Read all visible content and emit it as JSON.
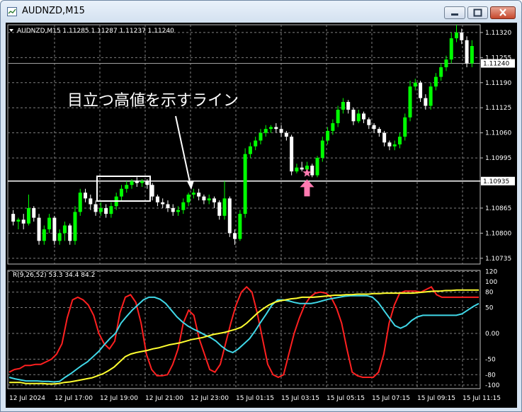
{
  "window": {
    "title": "AUDNZD,M15"
  },
  "colors": {
    "background": "#000000",
    "bull": "#00ff00",
    "bear": "#ffffff",
    "grid": "#7f7f7f",
    "red_line": "#ff2020",
    "cyan_line": "#40d8e8",
    "yellow_line": "#ffff30",
    "marker": "#ff7ab0"
  },
  "chart_data": [
    {
      "type": "candlestick",
      "header": "AUDNZD,M15  1.11285 1.11287 1.11237 1.11240",
      "ylim": [
        1.1072,
        1.1134
      ],
      "y_ticks": [
        "1.11320",
        "1.11255",
        "1.11190",
        "1.11125",
        "1.11060",
        "1.10995",
        "1.10935",
        "1.10865",
        "1.10800",
        "1.10735"
      ],
      "current_price_label": "1.11240",
      "current_price": 1.1124,
      "horizontal_line_label": "1.10935",
      "horizontal_line_price": 1.10935,
      "x_ticks": [
        "12 Jul 2024",
        "12 Jul 17:00",
        "12 Jul 19:00",
        "12 Jul 21:00",
        "12 Jul 23:00",
        "15 Jul 01:15",
        "15 Jul 03:15",
        "15 Jul 05:15",
        "15 Jul 07:15",
        "15 Jul 09:15",
        "15 Jul 11:15"
      ],
      "annotation_text": "目立つ高値を示すライン",
      "candles": [
        [
          1.1085,
          1.1083,
          1.1086,
          1.1082
        ],
        [
          1.1083,
          1.10835,
          1.1084,
          1.1081
        ],
        [
          1.10835,
          1.10825,
          1.1085,
          1.1081
        ],
        [
          1.10825,
          1.10865,
          1.109,
          1.1082
        ],
        [
          1.10865,
          1.1084,
          1.1087,
          1.1083
        ],
        [
          1.1084,
          1.1078,
          1.1085,
          1.1077
        ],
        [
          1.1078,
          1.1081,
          1.1082,
          1.1077
        ],
        [
          1.1081,
          1.1084,
          1.1085,
          1.108
        ],
        [
          1.1084,
          1.1078,
          1.10845,
          1.1077
        ],
        [
          1.1078,
          1.108,
          1.1081,
          1.1077
        ],
        [
          1.108,
          1.1082,
          1.1083,
          1.1078
        ],
        [
          1.1082,
          1.1078,
          1.10825,
          1.1077
        ],
        [
          1.1078,
          1.10855,
          1.1087,
          1.1077
        ],
        [
          1.10855,
          1.10905,
          1.10915,
          1.10845
        ],
        [
          1.10905,
          1.1089,
          1.10915,
          1.1088
        ],
        [
          1.1089,
          1.10875,
          1.109,
          1.1086
        ],
        [
          1.10875,
          1.10855,
          1.10885,
          1.10845
        ],
        [
          1.10855,
          1.10865,
          1.1088,
          1.10845
        ],
        [
          1.10865,
          1.1085,
          1.10875,
          1.1084
        ],
        [
          1.1085,
          1.1087,
          1.1088,
          1.1084
        ],
        [
          1.1087,
          1.10895,
          1.10905,
          1.1086
        ],
        [
          1.10895,
          1.10915,
          1.10925,
          1.10885
        ],
        [
          1.10915,
          1.10925,
          1.10935,
          1.10905
        ],
        [
          1.10925,
          1.10935,
          1.1094,
          1.10915
        ],
        [
          1.10935,
          1.1093,
          1.10945,
          1.1092
        ],
        [
          1.1093,
          1.10935,
          1.1094,
          1.1092
        ],
        [
          1.10935,
          1.10925,
          1.1094,
          1.10915
        ],
        [
          1.10925,
          1.10895,
          1.1093,
          1.10885
        ],
        [
          1.10895,
          1.1088,
          1.109,
          1.1087
        ],
        [
          1.1088,
          1.10875,
          1.1089,
          1.10865
        ],
        [
          1.10875,
          1.10865,
          1.10885,
          1.10855
        ],
        [
          1.10865,
          1.10855,
          1.10875,
          1.10845
        ],
        [
          1.10855,
          1.1086,
          1.1087,
          1.10845
        ],
        [
          1.1086,
          1.1088,
          1.1089,
          1.1085
        ],
        [
          1.1088,
          1.109,
          1.10905,
          1.1087
        ],
        [
          1.109,
          1.10905,
          1.10915,
          1.1089
        ],
        [
          1.10905,
          1.10895,
          1.10915,
          1.10885
        ],
        [
          1.10895,
          1.10885,
          1.109,
          1.10875
        ],
        [
          1.10885,
          1.1089,
          1.109,
          1.10875
        ],
        [
          1.1089,
          1.1088,
          1.10895,
          1.10865
        ],
        [
          1.1088,
          1.10845,
          1.10885,
          1.10835
        ],
        [
          1.10845,
          1.1089,
          1.10935,
          1.10835
        ],
        [
          1.1089,
          1.108,
          1.10895,
          1.1079
        ],
        [
          1.108,
          1.10785,
          1.1081,
          1.1077
        ],
        [
          1.10785,
          1.1085,
          1.1086,
          1.1078
        ],
        [
          1.1085,
          1.11005,
          1.1102,
          1.1084
        ],
        [
          1.11005,
          1.11025,
          1.11035,
          1.10995
        ],
        [
          1.11025,
          1.1104,
          1.1105,
          1.11015
        ],
        [
          1.1104,
          1.1106,
          1.1107,
          1.1103
        ],
        [
          1.1106,
          1.1107,
          1.1108,
          1.1105
        ],
        [
          1.1107,
          1.11075,
          1.1108,
          1.1106
        ],
        [
          1.11075,
          1.1107,
          1.11085,
          1.1106
        ],
        [
          1.1107,
          1.1106,
          1.1108,
          1.1105
        ],
        [
          1.1106,
          1.1105,
          1.11065,
          1.1104
        ],
        [
          1.1105,
          1.1096,
          1.11055,
          1.1095
        ],
        [
          1.1096,
          1.1097,
          1.1098,
          1.10955
        ],
        [
          1.1097,
          1.10965,
          1.10985,
          1.1096
        ],
        [
          1.10965,
          1.10975,
          1.10985,
          1.1096
        ],
        [
          1.10975,
          1.1095,
          1.1098,
          1.10945
        ],
        [
          1.1095,
          1.10995,
          1.11,
          1.10945
        ],
        [
          1.10995,
          1.1104,
          1.1105,
          1.10985
        ],
        [
          1.1104,
          1.11065,
          1.11075,
          1.1103
        ],
        [
          1.11065,
          1.11085,
          1.11095,
          1.11055
        ],
        [
          1.11085,
          1.1112,
          1.1113,
          1.11075
        ],
        [
          1.1112,
          1.1114,
          1.1115,
          1.1111
        ],
        [
          1.1114,
          1.1112,
          1.11145,
          1.1111
        ],
        [
          1.1112,
          1.1109,
          1.11125,
          1.1108
        ],
        [
          1.1109,
          1.1111,
          1.1112,
          1.11085
        ],
        [
          1.1111,
          1.11095,
          1.11115,
          1.11085
        ],
        [
          1.11095,
          1.1108,
          1.111,
          1.1107
        ],
        [
          1.1108,
          1.1107,
          1.11085,
          1.1106
        ],
        [
          1.1107,
          1.1106,
          1.11075,
          1.1105
        ],
        [
          1.1106,
          1.11035,
          1.11065,
          1.11025
        ],
        [
          1.11035,
          1.11025,
          1.1104,
          1.11015
        ],
        [
          1.11025,
          1.1103,
          1.1104,
          1.11015
        ],
        [
          1.1103,
          1.1105,
          1.1106,
          1.1102
        ],
        [
          1.1105,
          1.111,
          1.1111,
          1.1104
        ],
        [
          1.111,
          1.1118,
          1.11195,
          1.1109
        ],
        [
          1.1118,
          1.1119,
          1.112,
          1.1117
        ],
        [
          1.1119,
          1.1115,
          1.11195,
          1.1114
        ],
        [
          1.1115,
          1.1113,
          1.1116,
          1.1112
        ],
        [
          1.1113,
          1.1118,
          1.1119,
          1.1112
        ],
        [
          1.1118,
          1.11205,
          1.11215,
          1.1117
        ],
        [
          1.11205,
          1.1123,
          1.1124,
          1.11195
        ],
        [
          1.1123,
          1.1125,
          1.1126,
          1.1122
        ],
        [
          1.1125,
          1.11305,
          1.1132,
          1.1124
        ],
        [
          1.11305,
          1.1132,
          1.1134,
          1.11295
        ],
        [
          1.1132,
          1.113,
          1.1133,
          1.1129
        ],
        [
          1.113,
          1.1124,
          1.1131,
          1.1123
        ],
        [
          1.1124,
          1.11285,
          1.113,
          1.1123
        ]
      ]
    },
    {
      "type": "line",
      "label": "R(9,26,52) 53.3 34.4 84.2",
      "ylim": [
        -107,
        122
      ],
      "y_ticks": [
        120,
        100,
        80,
        50,
        0.0,
        -50,
        -80,
        -100
      ],
      "series": [
        {
          "color": "#ff2020",
          "values": [
            -75,
            -70,
            -68,
            -62,
            -62,
            -60,
            -60,
            -55,
            -50,
            -40,
            -20,
            30,
            65,
            70,
            65,
            55,
            35,
            0,
            -20,
            -30,
            -15,
            40,
            70,
            75,
            60,
            20,
            -40,
            -70,
            -82,
            -82,
            -80,
            -60,
            -30,
            20,
            45,
            35,
            -10,
            -40,
            -70,
            -75,
            -60,
            -20,
            20,
            55,
            80,
            90,
            80,
            40,
            -10,
            -60,
            -80,
            -85,
            -80,
            -40,
            0,
            30,
            55,
            70,
            78,
            80,
            78,
            70,
            50,
            20,
            -30,
            -75,
            -82,
            -85,
            -85,
            -85,
            -75,
            -40,
            20,
            55,
            78,
            82,
            82,
            82,
            80,
            85,
            90,
            75,
            70,
            70,
            70,
            70,
            70,
            70,
            70,
            70
          ]
        },
        {
          "color": "#40d8e8",
          "values": [
            -85,
            -88,
            -90,
            -92,
            -92,
            -92,
            -93,
            -93,
            -94,
            -93,
            -85,
            -78,
            -70,
            -62,
            -55,
            -45,
            -35,
            -22,
            -10,
            0,
            20,
            33,
            45,
            55,
            65,
            70,
            70,
            66,
            58,
            45,
            32,
            22,
            14,
            8,
            3,
            -3,
            -8,
            -15,
            -25,
            -33,
            -37,
            -30,
            -20,
            -10,
            5,
            22,
            38,
            55,
            65,
            65,
            63,
            60,
            58,
            58,
            58,
            60,
            63,
            66,
            68,
            70,
            72,
            73,
            73,
            73,
            73,
            70,
            60,
            45,
            30,
            15,
            10,
            15,
            25,
            32,
            35,
            35,
            35,
            35,
            35,
            35,
            35,
            38,
            45,
            52,
            58
          ]
        },
        {
          "color": "#ffff30",
          "values": [
            -95,
            -95,
            -95,
            -97,
            -97,
            -97,
            -97,
            -98,
            -98,
            -97,
            -95,
            -94,
            -92,
            -90,
            -88,
            -86,
            -82,
            -78,
            -72,
            -65,
            -55,
            -45,
            -40,
            -37,
            -35,
            -33,
            -30,
            -28,
            -25,
            -22,
            -20,
            -18,
            -15,
            -12,
            -10,
            -8,
            -5,
            -2,
            0,
            2,
            5,
            8,
            12,
            20,
            30,
            40,
            48,
            55,
            60,
            63,
            65,
            67,
            68,
            70,
            70,
            70,
            71,
            72,
            73,
            74,
            74,
            75,
            75,
            76,
            76,
            76,
            77,
            77,
            78,
            78,
            78,
            78,
            78,
            78,
            79,
            80,
            81,
            82,
            82,
            83,
            83,
            84,
            84,
            84,
            84,
            84
          ]
        }
      ]
    }
  ]
}
